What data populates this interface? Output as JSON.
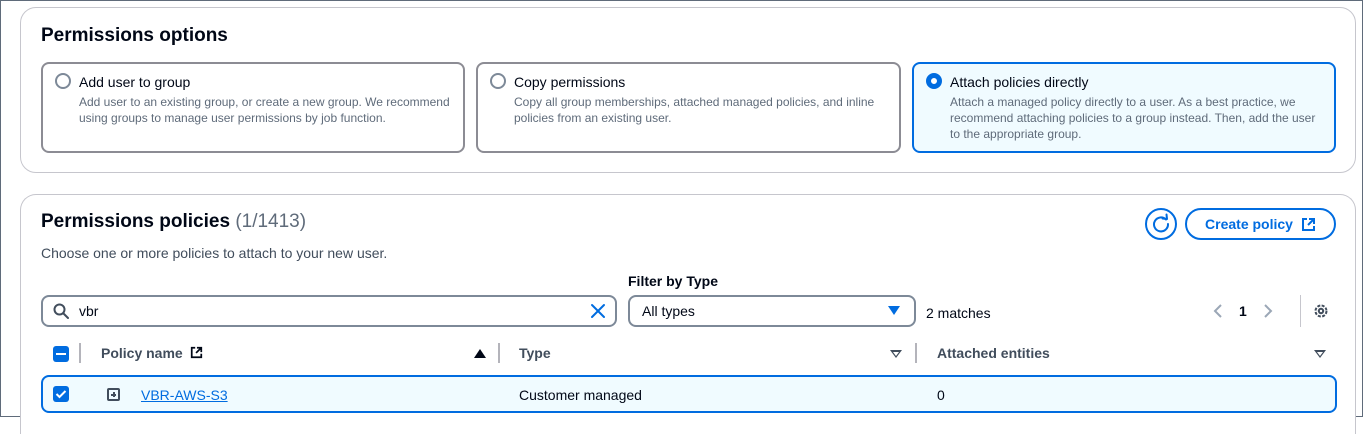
{
  "permissions_options": {
    "title": "Permissions options",
    "options": [
      {
        "label": "Add user to group",
        "description": "Add user to an existing group, or create a new group. We recommend using groups to manage user permissions by job function.",
        "selected": false
      },
      {
        "label": "Copy permissions",
        "description": "Copy all group memberships, attached managed policies, and inline policies from an existing user.",
        "selected": false
      },
      {
        "label": "Attach policies directly",
        "description": "Attach a managed policy directly to a user. As a best practice, we recommend attaching policies to a group instead. Then, add the user to the appropriate group.",
        "selected": true
      }
    ]
  },
  "permissions_policies": {
    "title": "Permissions policies",
    "count": "(1/1413)",
    "subtitle": "Choose one or more policies to attach to your new user.",
    "refresh_icon": "refresh-icon",
    "create_policy_label": "Create policy",
    "search": {
      "value": "vbr"
    },
    "filter": {
      "label": "Filter by Type",
      "selected": "All types"
    },
    "matches": "2 matches",
    "pagination": {
      "current_page": "1"
    },
    "columns": {
      "policy_name": "Policy name",
      "type": "Type",
      "attached_entities": "Attached entities"
    },
    "rows": [
      {
        "policy_name": "VBR-AWS-S3",
        "type": "Customer managed",
        "attached_entities": "0",
        "selected": true
      }
    ]
  },
  "colors": {
    "accent": "#006ce0",
    "selected_bg": "#f0fbff",
    "border": "#7d8998"
  }
}
